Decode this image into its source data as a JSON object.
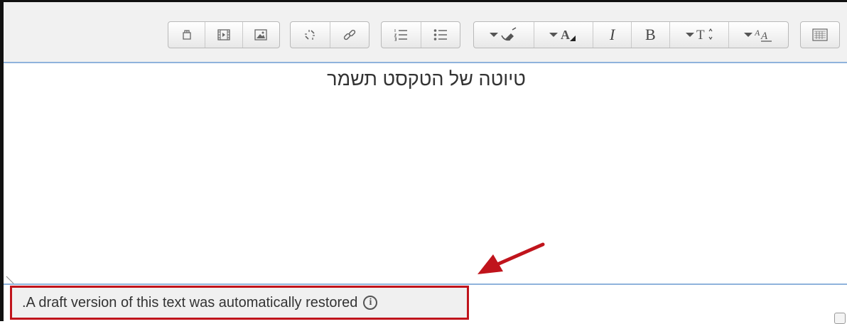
{
  "toolbar": {
    "groups": [
      {
        "name": "media",
        "buttons": [
          "manage-files-icon",
          "media-icon",
          "image-icon"
        ]
      },
      {
        "name": "links",
        "buttons": [
          "unlink-icon",
          "link-icon"
        ]
      },
      {
        "name": "lists",
        "buttons": [
          "ordered-list-icon",
          "unordered-list-icon"
        ]
      },
      {
        "name": "formatting",
        "buttons": [
          "clear-formatting-icon",
          "font-color-icon",
          "italic-icon",
          "bold-icon",
          "font-size-icon",
          "font-style-icon"
        ]
      },
      {
        "name": "toggle",
        "buttons": [
          "toolbar-toggle-icon"
        ]
      }
    ],
    "italic_label": "I",
    "bold_label": "B"
  },
  "editor": {
    "content": "טיוטה של הטקסט תשמר"
  },
  "notice": {
    "text": ".A draft version of this text was automatically restored",
    "info_symbol": "i"
  },
  "colors": {
    "annotation_red": "#c0141c",
    "focus_blue": "#8fb3dc"
  }
}
